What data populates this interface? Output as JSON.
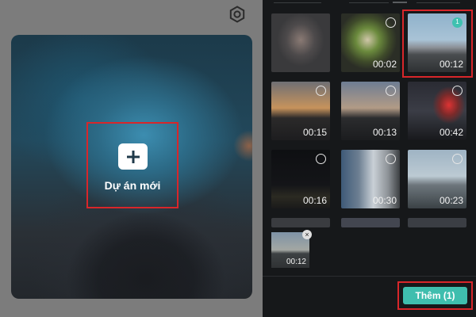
{
  "left_panel": {
    "new_project_label": "Dự án mới"
  },
  "media_grid": [
    {
      "duration": "",
      "selected": false
    },
    {
      "duration": "00:02",
      "selected": false
    },
    {
      "duration": "00:12",
      "selected": true,
      "badge": "1"
    },
    {
      "duration": "00:15",
      "selected": false
    },
    {
      "duration": "00:13",
      "selected": false
    },
    {
      "duration": "00:42",
      "selected": false
    },
    {
      "duration": "00:16",
      "selected": false
    },
    {
      "duration": "00:30",
      "selected": false
    },
    {
      "duration": "00:23",
      "selected": false
    }
  ],
  "selection_tray": {
    "duration": "00:12",
    "remove_glyph": "×"
  },
  "footer": {
    "add_button_label": "Thêm (1)"
  },
  "colors": {
    "accent": "#3fbeae",
    "highlight": "#d8262a",
    "panel_dark": "#16181a"
  },
  "icons": {
    "settings": "gear-icon",
    "add": "plus-icon",
    "remove": "close-icon"
  }
}
